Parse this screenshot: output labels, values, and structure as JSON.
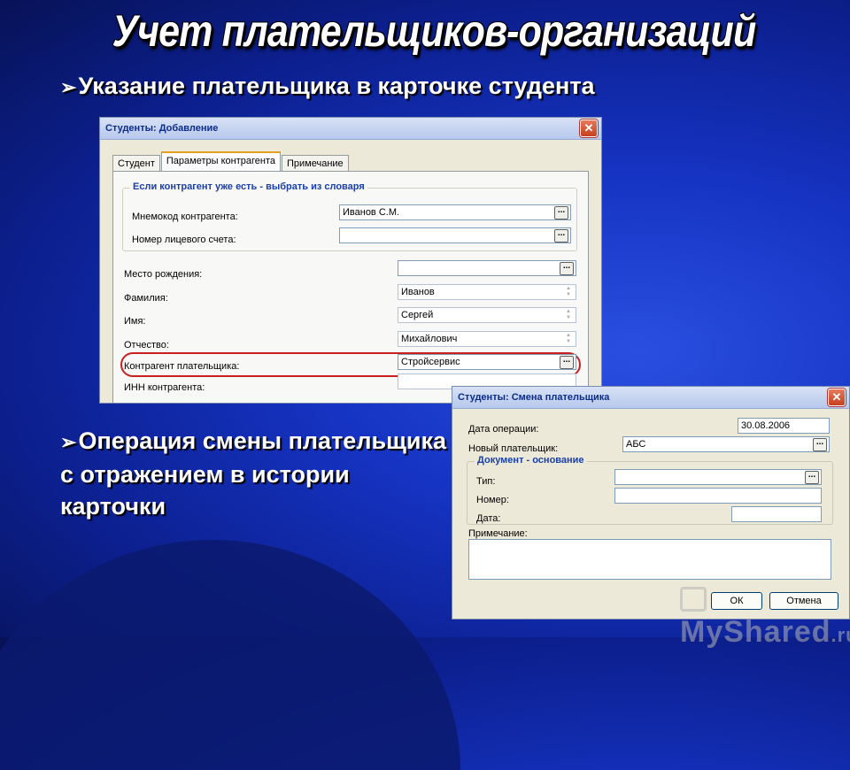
{
  "slide": {
    "title": "Учет плательщиков-организаций",
    "bullet1": "Указание плательщика в карточке студента",
    "bullet2": "Операция смены плательщика с отражением в истории карточки",
    "bullet_icon": "arrow-bullet-icon"
  },
  "window1": {
    "title": "Студенты: Добавление",
    "tabs": [
      "Студент",
      "Параметры контрагента",
      "Примечание"
    ],
    "active_tab": "Параметры контрагента",
    "group_title": "Если контрагент уже есть - выбрать из словаря",
    "fields": {
      "mnemocode": {
        "label": "Мнемокод контрагента:",
        "value": "Иванов С.М."
      },
      "account": {
        "label": "Номер лицевого счета:",
        "value": ""
      },
      "birthplace": {
        "label": "Место рождения:",
        "value": ""
      },
      "lastname": {
        "label": "Фамилия:",
        "value": "Иванов"
      },
      "firstname": {
        "label": "Имя:",
        "value": "Сергей"
      },
      "patronymic": {
        "label": "Отчество:",
        "value": "Михайлович"
      },
      "payer": {
        "label": "Контрагент плательщика:",
        "value": "Стройсервис"
      },
      "inn": {
        "label": "ИНН контрагента:",
        "value": ""
      }
    },
    "highlight_color": "#c8201f"
  },
  "window2": {
    "title": "Студенты: Смена плательщика",
    "fields": {
      "op_date": {
        "label": "Дата операции:",
        "value": "30.08.2006"
      },
      "new_payer": {
        "label": "Новый плательщик:",
        "value": "АБС"
      }
    },
    "group_title": "Документ - основание",
    "doc_fields": {
      "type": {
        "label": "Тип:",
        "value": ""
      },
      "number": {
        "label": "Номер:",
        "value": ""
      },
      "date": {
        "label": "Дата:",
        "value": ""
      }
    },
    "note_label": "Примечание:",
    "ok_label": "ОК",
    "cancel_label": "Отмена"
  },
  "watermark": {
    "text": "MyShared",
    "suffix": ".ru"
  },
  "colors": {
    "background": "#1634c4",
    "title_text": "#ffffff",
    "group_title": "#1a3fa8"
  }
}
